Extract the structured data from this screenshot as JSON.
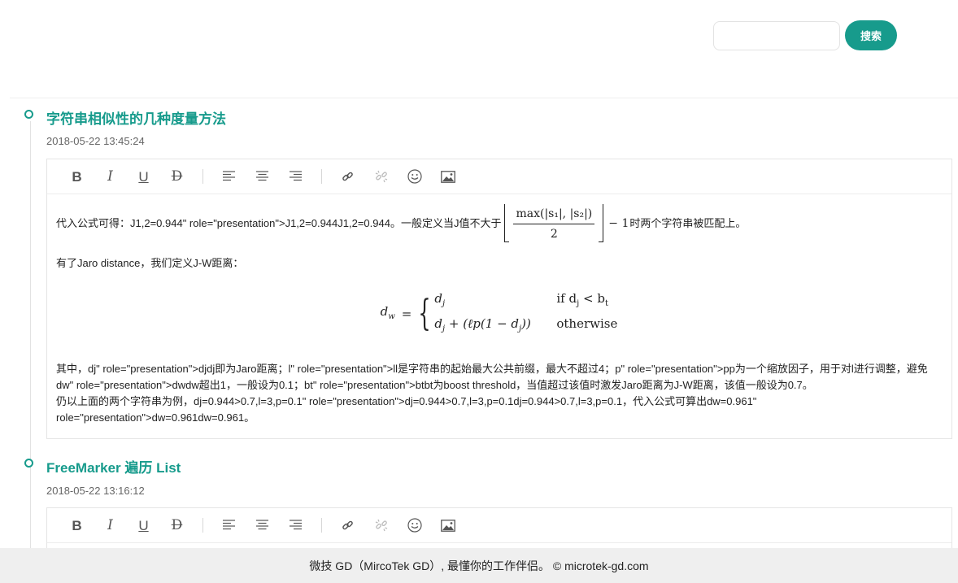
{
  "search": {
    "placeholder": "",
    "button_label": "搜索"
  },
  "toolbar": {
    "items": [
      {
        "name": "bold-button",
        "glyph": "B",
        "icon": "bold-icon"
      },
      {
        "name": "italic-button",
        "glyph": "I",
        "icon": "italic-icon"
      },
      {
        "name": "underline-button",
        "glyph": "U",
        "icon": "underline-icon"
      },
      {
        "name": "strikethrough-button",
        "glyph": "D",
        "icon": "strikethrough-icon"
      },
      {
        "name": "align-left-button",
        "icon": "align-left-icon"
      },
      {
        "name": "align-center-button",
        "icon": "align-center-icon"
      },
      {
        "name": "align-right-button",
        "icon": "align-right-icon"
      },
      {
        "name": "link-button",
        "icon": "link-icon"
      },
      {
        "name": "unlink-button",
        "icon": "unlink-icon"
      },
      {
        "name": "emoji-button",
        "icon": "smiley-icon"
      },
      {
        "name": "image-button",
        "icon": "image-icon"
      }
    ]
  },
  "posts": [
    {
      "title": "字符串相似性的几种度量方法",
      "date": "2018-05-22 13:45:24",
      "content": {
        "p1_prefix": "代入公式可得：J1,2=0.944\" role=\"presentation\">J1,2=0.944J1,2=0.944。一般定义当J值不大于",
        "p1_frac_num": "max(|s₁|, |s₂|)",
        "p1_frac_den": "2",
        "p1_suffix_math": "− 1",
        "p1_suffix": "时两个字符串被匹配上。",
        "p2": "有了Jaro distance，我们定义J-W距离：",
        "eq_lhs": "d",
        "eq_lhs_sub": "w",
        "eq_row1_left": "d",
        "eq_row1_left_sub": "j",
        "eq_row1_right": "if d",
        "eq_row1_right_sub": "j",
        "eq_row1_right_tail": " < b",
        "eq_row1_right_tail_sub": "t",
        "eq_row2_left": "d",
        "eq_row2_left_sub": "j",
        "eq_row2_left_tail": " + (ℓp(1 − d",
        "eq_row2_left_tail_sub": "j",
        "eq_row2_left_close": "))",
        "eq_row2_right": "otherwise",
        "p3": "其中，dj\" role=\"presentation\">djdj即为Jaro距离；l\" role=\"presentation\">ll是字符串的起始最大公共前缀，最大不超过4；p\" role=\"presentation\">pp为一个缩放因子，用于对l进行调整，避免dw\" role=\"presentation\">dwdw超出1，一般设为0.1；bt\" role=\"presentation\">btbt为boost threshold，当值超过该值时激发Jaro距离为J-W距离，该值一般设为0.7。",
        "p4": "仍以上面的两个字符串为例，dj=0.944>0.7,l=3,p=0.1\" role=\"presentation\">dj=0.944>0.7,l=3,p=0.1dj=0.944>0.7,l=3,p=0.1，代入公式可算出dw=0.961\" role=\"presentation\">dw=0.961dw=0.961。"
      }
    },
    {
      "title": "FreeMarker 遍历 List",
      "date": "2018-05-22 13:16:12"
    }
  ],
  "footer": {
    "text": "微技 GD（MircoTek GD）, 最懂你的工作伴侣。 © microtek-gd.com"
  },
  "colors": {
    "accent": "#179b8c",
    "footer_bg": "#efefef"
  }
}
